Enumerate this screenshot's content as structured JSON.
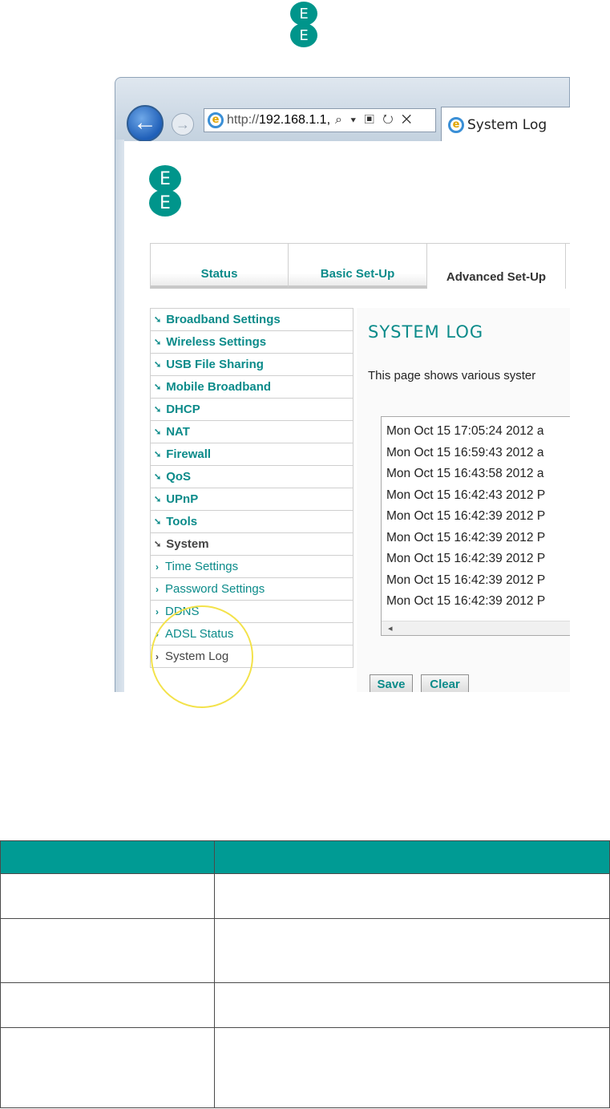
{
  "logo": {
    "letters": [
      "E",
      "E"
    ]
  },
  "browser": {
    "url_prefix": "http://",
    "url_host": "192.168.1.1",
    "url_trailing": ",",
    "address_tools": "⌕ ▾ ▣ ↻ ✕",
    "tab_title": "System Log"
  },
  "nav_tabs": [
    "Status",
    "Basic Set-Up",
    "Advanced Set-Up"
  ],
  "left_nav": {
    "main_items": [
      "Broadband Settings",
      "Wireless Settings",
      "USB File Sharing",
      "Mobile Broadband",
      "DHCP",
      "NAT",
      "Firewall",
      "QoS",
      "UPnP",
      "Tools",
      "System"
    ],
    "sub_items": [
      "Time Settings",
      "Password Settings",
      "DDNS",
      "ADSL Status",
      "System Log"
    ]
  },
  "page": {
    "title": "SYSTEM LOG",
    "description": "This page shows various syster",
    "log_lines": [
      "Mon Oct 15 17:05:24 2012 a",
      "Mon Oct 15 16:59:43 2012 a",
      "Mon Oct 15 16:43:58 2012 a",
      "Mon Oct 15 16:42:43 2012 P",
      "Mon Oct 15 16:42:39 2012 P",
      "Mon Oct 15 16:42:39 2012 P",
      "Mon Oct 15 16:42:39 2012 P",
      "Mon Oct 15 16:42:39 2012 P",
      "Mon Oct 15 16:42:39 2012 P"
    ],
    "scroll_left": "◂",
    "save_label": "Save",
    "clear_label": "Clear"
  },
  "colors": {
    "brand": "#009b94",
    "highlight": "#f3e24a"
  }
}
